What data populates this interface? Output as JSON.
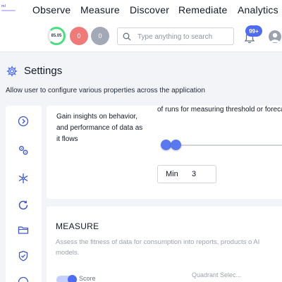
{
  "nav": {
    "logo_text": "ml",
    "items": [
      "Observe",
      "Measure",
      "Discover",
      "Remediate",
      "Analytics"
    ]
  },
  "status": {
    "score": "85.05",
    "red_count": "0",
    "gray_count": "0",
    "search_placeholder": "Type anything to search",
    "notification_badge": "99+"
  },
  "settings": {
    "title": "Settings",
    "subtitle": "Allow user to configure various properties across the application"
  },
  "rail": {
    "icons": [
      "chevron-right-circle-icon",
      "gears-icon",
      "snowflake-icon",
      "refresh-icon",
      "folder-icon",
      "shield-check-icon"
    ]
  },
  "observe_card": {
    "description": "Gain insights on behavior, and performance of data as it flows",
    "threshold_text": "of runs for measuring threshold or forecast",
    "unit_label": "Min",
    "unit_value": "3"
  },
  "measure_card": {
    "title": "MEASURE",
    "description": "Assess the fitness of data for consumption into reports, products o AI models.",
    "toggle_label": "Score",
    "quadrant_label": "Quadrant Selec..."
  },
  "colors": {
    "accent": "#4f6cf0",
    "ring_green": "#4ade80",
    "red_badge": "#ef7a7a",
    "gray_badge": "#a3a9b6"
  }
}
